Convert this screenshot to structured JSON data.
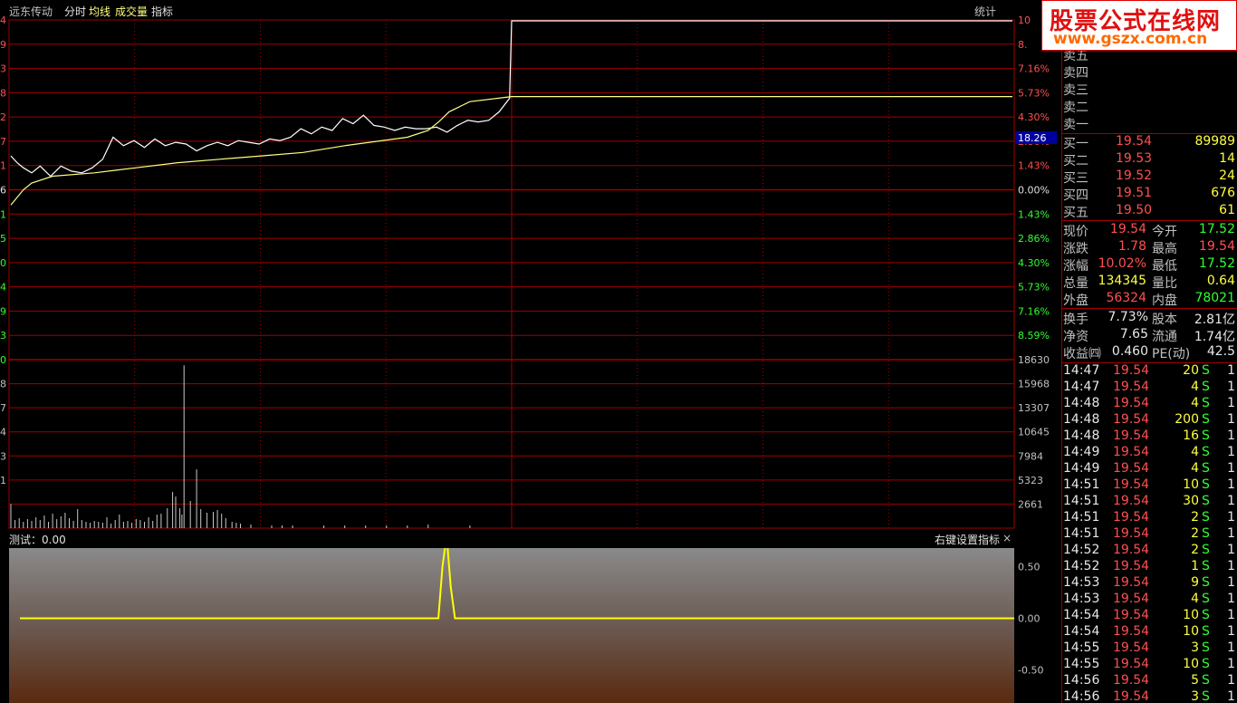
{
  "header": {
    "stock_name": "远东传动",
    "tabs": [
      "分时",
      "均线",
      "成交量",
      "指标"
    ],
    "stat_button": "统计"
  },
  "logo": {
    "text": "股票公式在线网",
    "url": "www.gszx.com.cn"
  },
  "price_axis": {
    "right_labels": [
      "10",
      "8.",
      "7.16%",
      "5.73%",
      "4.30%",
      "2.86%",
      "1.43%",
      "0.00%",
      "1.43%",
      "2.86%",
      "4.30%",
      "5.73%",
      "7.16%",
      "8.59%"
    ],
    "left_labels": [
      "4",
      "9",
      "3",
      "8",
      "2",
      "7",
      "1",
      "6",
      "1",
      "5",
      "0",
      "4",
      "9",
      "3",
      "0"
    ],
    "cursor_value": "18.26"
  },
  "volume_axis": {
    "right_labels": [
      "18630",
      "15968",
      "13307",
      "10645",
      "7984",
      "5323",
      "2661"
    ],
    "left_labels": [
      "8",
      "7",
      "4",
      "3",
      "1"
    ]
  },
  "indicator": {
    "title": "测试：0.00",
    "hint": "右键设置指标",
    "close": "×",
    "axis_labels": [
      "0.50",
      "0.00",
      "-0.50"
    ]
  },
  "chart_data": [
    {
      "type": "line",
      "ylabel": "",
      "x_range": [
        0,
        240
      ],
      "ylim_pct": [
        -10.02,
        10.02
      ],
      "series": [
        {
          "key": "price",
          "x": [
            0,
            3,
            6,
            10,
            14,
            19,
            24,
            29,
            34,
            39,
            44,
            49,
            54,
            59,
            64,
            69,
            74,
            79,
            84,
            89,
            94,
            99,
            104,
            109,
            114,
            119,
            124,
            129,
            134,
            139,
            144,
            149,
            154,
            159,
            164,
            169,
            174,
            179,
            184,
            189,
            194,
            199,
            204,
            209,
            214,
            219,
            224,
            229,
            234,
            239,
            240
          ],
          "values": [
            2.0,
            1.6,
            1.3,
            1.0,
            1.4,
            0.8,
            1.4,
            1.1,
            1.0,
            1.3,
            1.8,
            3.1,
            2.6,
            2.9,
            2.5,
            3.0,
            2.6,
            2.8,
            2.7,
            2.3,
            2.6,
            2.8,
            2.6,
            2.9,
            2.8,
            2.7,
            3.0,
            2.9,
            3.1,
            3.6,
            3.3,
            3.7,
            3.5,
            4.2,
            3.9,
            4.4,
            3.8,
            3.7,
            3.5,
            3.7,
            3.6,
            3.6,
            3.7,
            3.4,
            3.8,
            4.1,
            4.0,
            4.1,
            4.6,
            5.4,
            10.02
          ]
        },
        {
          "key": "average",
          "x": [
            0,
            6,
            10,
            20,
            40,
            60,
            80,
            100,
            120,
            140,
            160,
            190,
            200,
            205,
            210,
            220,
            240
          ],
          "values": [
            -0.9,
            0.0,
            0.4,
            0.8,
            1.0,
            1.3,
            1.6,
            1.8,
            2.0,
            2.2,
            2.6,
            3.1,
            3.5,
            4.0,
            4.6,
            5.2,
            5.5
          ]
        }
      ]
    },
    {
      "type": "bar",
      "ylabel": "",
      "ylim": [
        0,
        18630
      ],
      "x": [
        0,
        4,
        8,
        12,
        16,
        20,
        24,
        28,
        32,
        36,
        40,
        44,
        48,
        52,
        56,
        60,
        64,
        68,
        72,
        76,
        80,
        84,
        88,
        92,
        96,
        100,
        104,
        108,
        112,
        116,
        120,
        124,
        128,
        132,
        136,
        140,
        144,
        150,
        155,
        158,
        162,
        164,
        166,
        172,
        178,
        182,
        188,
        194,
        198,
        202,
        206,
        212,
        216,
        220,
        230,
        250,
        260,
        270,
        300,
        320,
        340,
        360,
        380,
        400,
        440
      ],
      "values": [
        2661,
        900,
        1100,
        700,
        1000,
        800,
        1200,
        900,
        1400,
        700,
        1600,
        1000,
        1300,
        1700,
        1100,
        800,
        2100,
        900,
        700,
        600,
        800,
        700,
        600,
        1200,
        500,
        900,
        1500,
        700,
        800,
        600,
        1000,
        900,
        700,
        1200,
        800,
        1500,
        1600,
        2200,
        4000,
        3500,
        2200,
        1500,
        18000,
        3000,
        6500,
        2100,
        1700,
        1800,
        2000,
        1600,
        1100,
        700,
        600,
        500,
        400,
        300,
        300,
        300,
        300,
        300,
        300,
        300,
        300,
        400,
        300
      ]
    },
    {
      "type": "line",
      "ylabel": "",
      "ylim": [
        -0.75,
        0.75
      ],
      "x": [
        0,
        101,
        102,
        103,
        104,
        105,
        240
      ],
      "values": [
        0,
        0,
        0.5,
        0.8,
        0.3,
        0,
        0
      ]
    }
  ],
  "order_book": {
    "asks": [
      {
        "label": "卖五",
        "price": "",
        "volume": ""
      },
      {
        "label": "卖四",
        "price": "",
        "volume": ""
      },
      {
        "label": "卖三",
        "price": "",
        "volume": ""
      },
      {
        "label": "卖二",
        "price": "",
        "volume": ""
      },
      {
        "label": "卖一",
        "price": "",
        "volume": ""
      }
    ],
    "bids": [
      {
        "label": "买一",
        "price": "19.54",
        "volume": "89989"
      },
      {
        "label": "买二",
        "price": "19.53",
        "volume": "14"
      },
      {
        "label": "买三",
        "price": "19.52",
        "volume": "24"
      },
      {
        "label": "买四",
        "price": "19.51",
        "volume": "676"
      },
      {
        "label": "买五",
        "price": "19.50",
        "volume": "61"
      }
    ]
  },
  "quote": [
    {
      "l1": "现价",
      "v1": "19.54",
      "l2": "今开",
      "v2": "17.52",
      "c1": "red",
      "c2": "grn"
    },
    {
      "l1": "涨跌",
      "v1": "1.78",
      "l2": "最高",
      "v2": "19.54",
      "c1": "red",
      "c2": "red"
    },
    {
      "l1": "涨幅",
      "v1": "10.02%",
      "l2": "最低",
      "v2": "17.52",
      "c1": "red",
      "c2": "grn"
    },
    {
      "l1": "总量",
      "v1": "134345",
      "l2": "量比",
      "v2": "0.64",
      "c1": "yel",
      "c2": "yel"
    },
    {
      "l1": "外盘",
      "v1": "56324",
      "l2": "内盘",
      "v2": "78021",
      "c1": "red",
      "c2": "grn"
    }
  ],
  "fundamentals": [
    {
      "l1": "换手",
      "v1": "7.73%",
      "l2": "股本",
      "v2": "2.81亿"
    },
    {
      "l1": "净资",
      "v1": "7.65",
      "l2": "流通",
      "v2": "1.74亿"
    },
    {
      "l1": "收益㈣",
      "v1": "0.460",
      "l2": "PE(动)",
      "v2": "42.5"
    }
  ],
  "trades": [
    {
      "time": "14:47",
      "price": "19.54",
      "vol": "20",
      "side": "S",
      "n": "1"
    },
    {
      "time": "14:47",
      "price": "19.54",
      "vol": "4",
      "side": "S",
      "n": "1"
    },
    {
      "time": "14:48",
      "price": "19.54",
      "vol": "4",
      "side": "S",
      "n": "1"
    },
    {
      "time": "14:48",
      "price": "19.54",
      "vol": "200",
      "side": "S",
      "n": "1"
    },
    {
      "time": "14:48",
      "price": "19.54",
      "vol": "16",
      "side": "S",
      "n": "1"
    },
    {
      "time": "14:49",
      "price": "19.54",
      "vol": "4",
      "side": "S",
      "n": "1"
    },
    {
      "time": "14:49",
      "price": "19.54",
      "vol": "4",
      "side": "S",
      "n": "1"
    },
    {
      "time": "14:51",
      "price": "19.54",
      "vol": "10",
      "side": "S",
      "n": "1"
    },
    {
      "time": "14:51",
      "price": "19.54",
      "vol": "30",
      "side": "S",
      "n": "1"
    },
    {
      "time": "14:51",
      "price": "19.54",
      "vol": "2",
      "side": "S",
      "n": "1"
    },
    {
      "time": "14:51",
      "price": "19.54",
      "vol": "2",
      "side": "S",
      "n": "1"
    },
    {
      "time": "14:52",
      "price": "19.54",
      "vol": "2",
      "side": "S",
      "n": "1"
    },
    {
      "time": "14:52",
      "price": "19.54",
      "vol": "1",
      "side": "S",
      "n": "1"
    },
    {
      "time": "14:53",
      "price": "19.54",
      "vol": "9",
      "side": "S",
      "n": "1"
    },
    {
      "time": "14:53",
      "price": "19.54",
      "vol": "4",
      "side": "S",
      "n": "1"
    },
    {
      "time": "14:54",
      "price": "19.54",
      "vol": "10",
      "side": "S",
      "n": "1"
    },
    {
      "time": "14:54",
      "price": "19.54",
      "vol": "10",
      "side": "S",
      "n": "1"
    },
    {
      "time": "14:55",
      "price": "19.54",
      "vol": "3",
      "side": "S",
      "n": "1"
    },
    {
      "time": "14:55",
      "price": "19.54",
      "vol": "10",
      "side": "S",
      "n": "1"
    },
    {
      "time": "14:56",
      "price": "19.54",
      "vol": "5",
      "side": "S",
      "n": "1"
    },
    {
      "time": "14:56",
      "price": "19.54",
      "vol": "3",
      "side": "S",
      "n": "1"
    }
  ],
  "colors": {
    "grid": "#a00000",
    "price": "#ffffff",
    "average": "#ffff80",
    "volume": "#c8c8c8",
    "indicator": "#ffff00",
    "up": "#ff5050",
    "down": "#30ff30"
  }
}
